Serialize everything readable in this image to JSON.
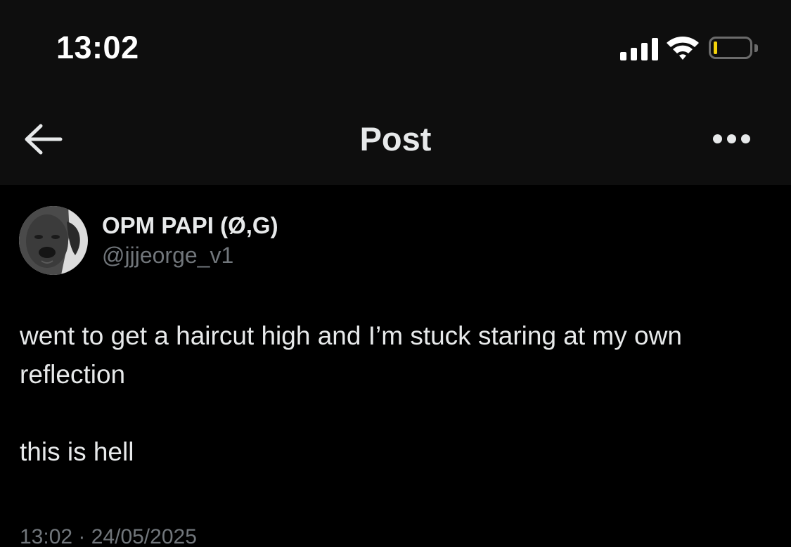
{
  "status_bar": {
    "time": "13:02",
    "signal_icon": "cellular-signal-icon",
    "wifi_icon": "wifi-icon",
    "battery_icon": "battery-icon",
    "battery_level": 0.1,
    "battery_color": "#f4d30a"
  },
  "header": {
    "back_icon": "arrow-left-icon",
    "title": "Post",
    "more_icon": "more-horizontal-icon"
  },
  "post": {
    "author": {
      "display_name": "OPM PAPI (Ø,G)",
      "handle": "@jjjeorge_v1",
      "avatar_icon": "dog-avatar-icon"
    },
    "text": [
      "went to get a haircut high and I’m stuck staring at my own reflection",
      "this is hell"
    ],
    "timestamp": "13:02 · 24/05/2025"
  },
  "colors": {
    "background": "#000000",
    "header_background": "#0e0e0e",
    "primary_text": "#e7e9ea",
    "secondary_text": "#71767b"
  }
}
